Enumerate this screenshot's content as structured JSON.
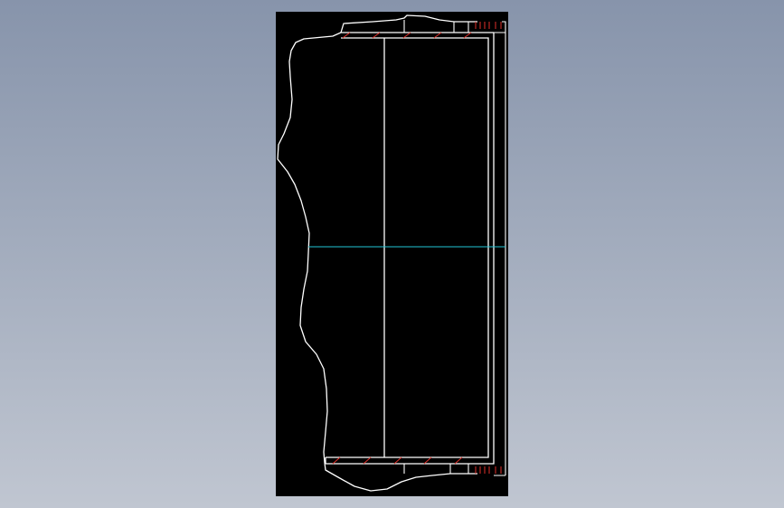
{
  "colors": {
    "background_top": "#8794ab",
    "background_bottom": "#c0c6d1",
    "canvas": "#000000",
    "outline": "#ffffff",
    "centerline": "#22c6d6",
    "hatch": "#e0302a"
  },
  "drawing": {
    "kind": "cad-section-view",
    "contents": [
      "break-line-outline",
      "rectangular-section",
      "centerline",
      "hatch-marks"
    ]
  }
}
